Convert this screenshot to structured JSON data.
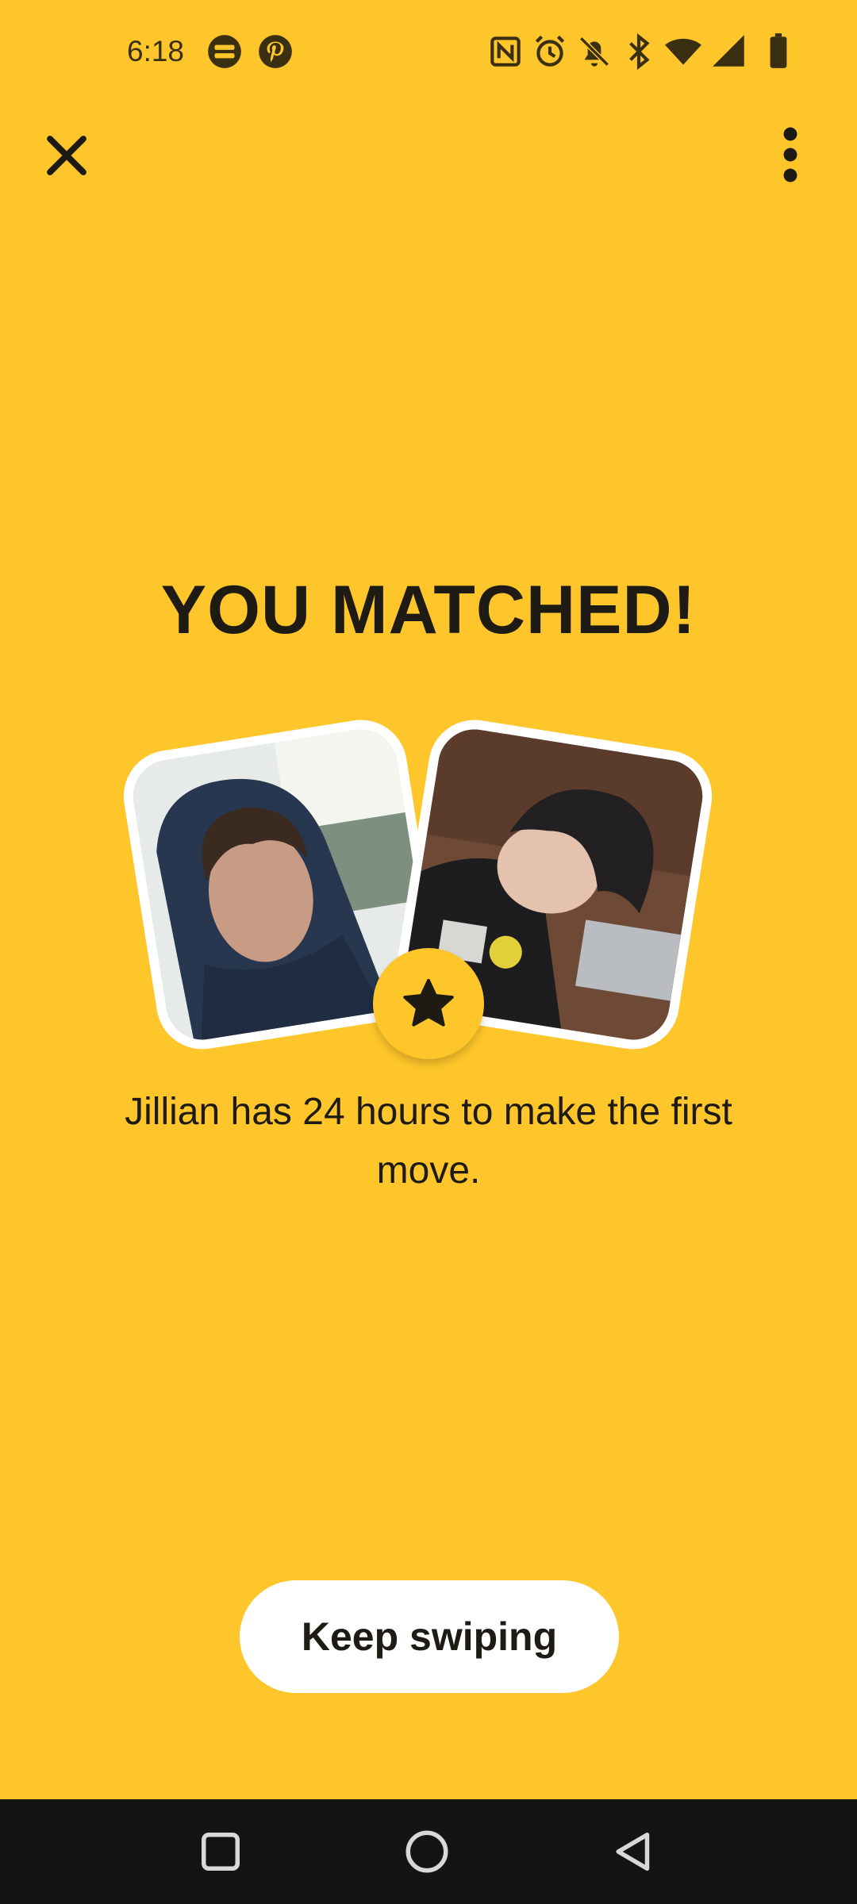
{
  "status_bar": {
    "time": "6:18",
    "left_icons": [
      "trello-icon",
      "pinterest-icon"
    ],
    "right_icons": [
      "nfc-icon",
      "alarm-icon",
      "notifications-off-icon",
      "bluetooth-icon",
      "wifi-icon",
      "signal-icon",
      "battery-icon"
    ]
  },
  "header": {
    "close_icon": "close-icon",
    "more_icon": "more-vertical-icon"
  },
  "match": {
    "title": "YOU MATCHED!",
    "message": "Jillian has 24 hours to make the first move.",
    "badge_icon": "star-icon"
  },
  "actions": {
    "keep_swiping_label": "Keep swiping"
  },
  "nav": {
    "recents_icon": "square-icon",
    "home_icon": "circle-icon",
    "back_icon": "triangle-back-icon"
  },
  "colors": {
    "background": "#FEC62A",
    "text": "#1E1B14",
    "button": "#FFFFFF",
    "nav_bar": "#141414"
  }
}
